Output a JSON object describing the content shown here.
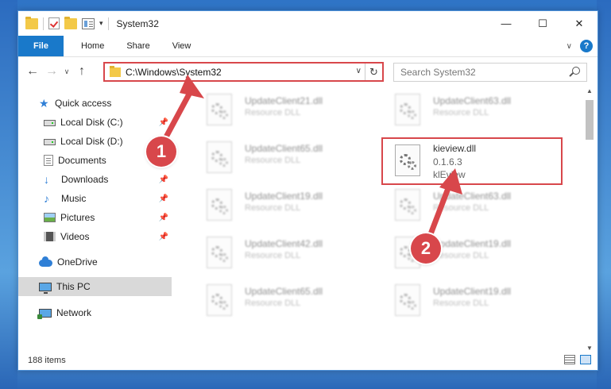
{
  "window": {
    "title": "System32"
  },
  "ribbon": {
    "tabs": [
      "File",
      "Home",
      "Share",
      "View"
    ]
  },
  "address": {
    "path": "C:\\Windows\\System32"
  },
  "search": {
    "placeholder": "Search System32"
  },
  "nav": {
    "items": [
      {
        "label": "Quick access",
        "icon": "star-icon",
        "pinned": false
      },
      {
        "label": "Local Disk (C:)",
        "icon": "drive-icon",
        "pinned": true
      },
      {
        "label": "Local Disk (D:)",
        "icon": "drive-icon",
        "pinned": false
      },
      {
        "label": "Documents",
        "icon": "documents-icon",
        "pinned": false
      },
      {
        "label": "Downloads",
        "icon": "downloads-icon",
        "pinned": true
      },
      {
        "label": "Music",
        "icon": "music-icon",
        "pinned": true
      },
      {
        "label": "Pictures",
        "icon": "pictures-icon",
        "pinned": true
      },
      {
        "label": "Videos",
        "icon": "videos-icon",
        "pinned": true
      },
      {
        "label": "OneDrive",
        "icon": "onedrive-icon",
        "pinned": false
      },
      {
        "label": "This PC",
        "icon": "this-pc-icon",
        "pinned": false,
        "selected": true
      },
      {
        "label": "Network",
        "icon": "network-icon",
        "pinned": false
      }
    ]
  },
  "files": [
    {
      "name": "UpdateClient21.dll",
      "type": "Resource DLL"
    },
    {
      "name": "UpdateClient63.dll",
      "type": "Resource DLL"
    },
    {
      "name": "UpdateClient65.dll",
      "type": "Resource DLL"
    },
    {
      "name": "kieview.dll",
      "version": "0.1.6.3",
      "description": "klEview"
    },
    {
      "name": "UpdateClient19.dll",
      "type": "Resource DLL"
    },
    {
      "name": "UpdateClient63.dll",
      "type": "Resource DLL"
    },
    {
      "name": "UpdateClient42.dll",
      "type": "Resource DLL"
    },
    {
      "name": "UpdateClient19.dll",
      "type": "Resource DLL"
    },
    {
      "name": "UpdateClient65.dll",
      "type": "Resource DLL"
    },
    {
      "name": "UpdateClient19.dll",
      "type": "Resource DLL"
    }
  ],
  "status": {
    "item_count": "188 items"
  },
  "callouts": {
    "one": "1",
    "two": "2"
  },
  "colors": {
    "accent": "#1979ca",
    "highlight": "#d8474b"
  }
}
